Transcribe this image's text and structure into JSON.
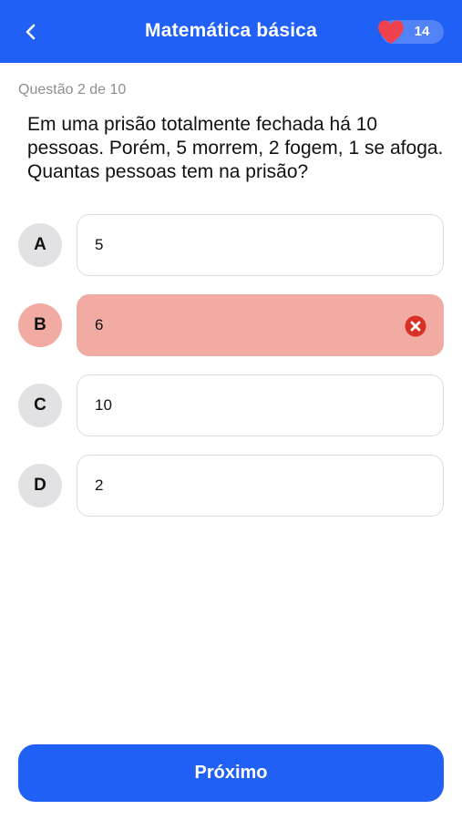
{
  "header": {
    "title": "Matemática básica",
    "lives": "14",
    "back_icon": "chevron-left-icon",
    "heart_icon": "heart-icon"
  },
  "quiz": {
    "progress": "Questão 2 de 10",
    "question": "Em uma prisão totalmente fechada há 10 pessoas. Porém, 5 morrem, 2 fogem, 1 se afoga. Quantas pessoas tem na prisão?",
    "options": [
      {
        "letter": "A",
        "text": "5",
        "state": "default"
      },
      {
        "letter": "B",
        "text": "6",
        "state": "wrong"
      },
      {
        "letter": "C",
        "text": "10",
        "state": "default"
      },
      {
        "letter": "D",
        "text": "2",
        "state": "default"
      }
    ]
  },
  "footer": {
    "next_label": "Próximo"
  },
  "colors": {
    "primary": "#2160f5",
    "wrong_bg": "#f2aba3",
    "wrong_icon": "#d93025",
    "heart": "#f0414f"
  }
}
